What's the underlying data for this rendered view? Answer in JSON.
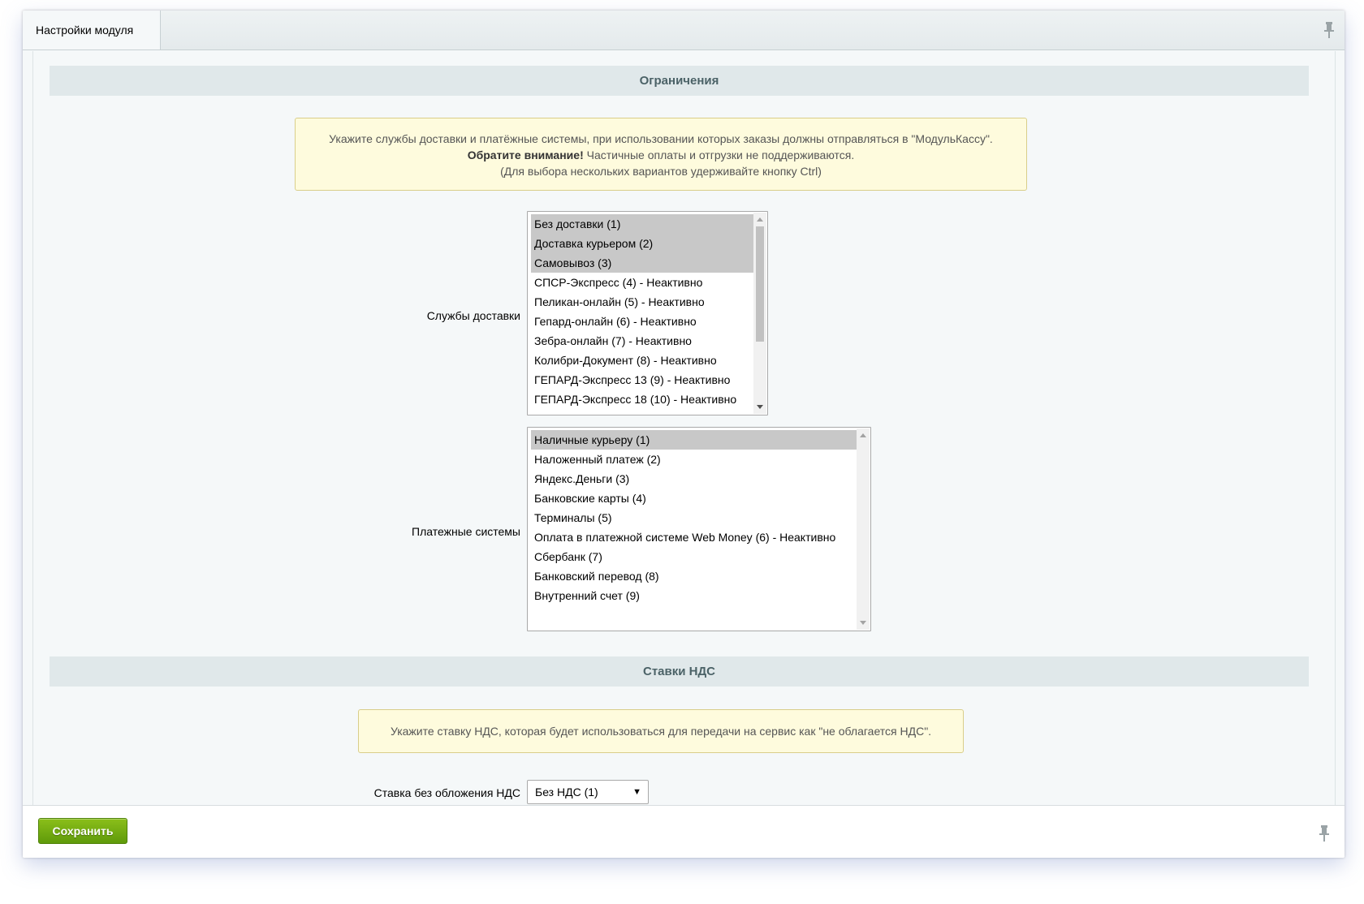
{
  "tab": {
    "label": "Настройки модуля"
  },
  "restrictions": {
    "heading": "Ограничения",
    "notice": {
      "line1": "Укажите службы доставки и платёжные системы, при использовании которых заказы должны отправляться в \"МодульКассу\".",
      "line2_bold": "Обратите внимание!",
      "line2_rest": " Частичные оплаты и отгрузки не поддерживаются.",
      "line3": "(Для выбора нескольких вариантов удерживайте кнопку Ctrl)"
    },
    "delivery": {
      "label": "Службы доставки",
      "options": [
        {
          "label": "Без доставки (1)",
          "selected": true
        },
        {
          "label": "Доставка курьером (2)",
          "selected": true
        },
        {
          "label": "Самовывоз (3)",
          "selected": true
        },
        {
          "label": "СПСР-Экспресс (4) - Неактивно",
          "selected": false
        },
        {
          "label": "Пеликан-онлайн (5) - Неактивно",
          "selected": false
        },
        {
          "label": "Гепард-онлайн (6) - Неактивно",
          "selected": false
        },
        {
          "label": "Зебра-онлайн (7) - Неактивно",
          "selected": false
        },
        {
          "label": "Колибри-Документ (8) - Неактивно",
          "selected": false
        },
        {
          "label": "ГЕПАРД-Экспресс 13 (9) - Неактивно",
          "selected": false
        },
        {
          "label": "ГЕПАРД-Экспресс 18 (10) - Неактивно",
          "selected": false
        }
      ]
    },
    "payment": {
      "label": "Платежные системы",
      "options": [
        {
          "label": "Наличные курьеру (1)",
          "selected": true
        },
        {
          "label": "Наложенный платеж (2)",
          "selected": false
        },
        {
          "label": "Яндекс.Деньги (3)",
          "selected": false
        },
        {
          "label": "Банковские карты (4)",
          "selected": false
        },
        {
          "label": "Терминалы (5)",
          "selected": false
        },
        {
          "label": "Оплата в платежной системе Web Money (6) - Неактивно",
          "selected": false
        },
        {
          "label": "Сбербанк (7)",
          "selected": false
        },
        {
          "label": "Банковский перевод (8)",
          "selected": false
        },
        {
          "label": "Внутренний счет (9)",
          "selected": false
        }
      ]
    }
  },
  "vat": {
    "heading": "Ставки НДС",
    "notice": "Укажите ставку НДС, которая будет использоваться для передачи на сервис как \"не облагается НДС\".",
    "field_label": "Ставка без обложения НДС",
    "selected_value": "Без НДС (1)"
  },
  "footer": {
    "save_label": "Сохранить"
  },
  "icons": {
    "pin": "pin-icon",
    "dropdown": "chevron-down-icon"
  },
  "colors": {
    "save_button": "#6aa510",
    "section_header": "#e0e8ea",
    "notice_bg": "#fefbdd"
  }
}
